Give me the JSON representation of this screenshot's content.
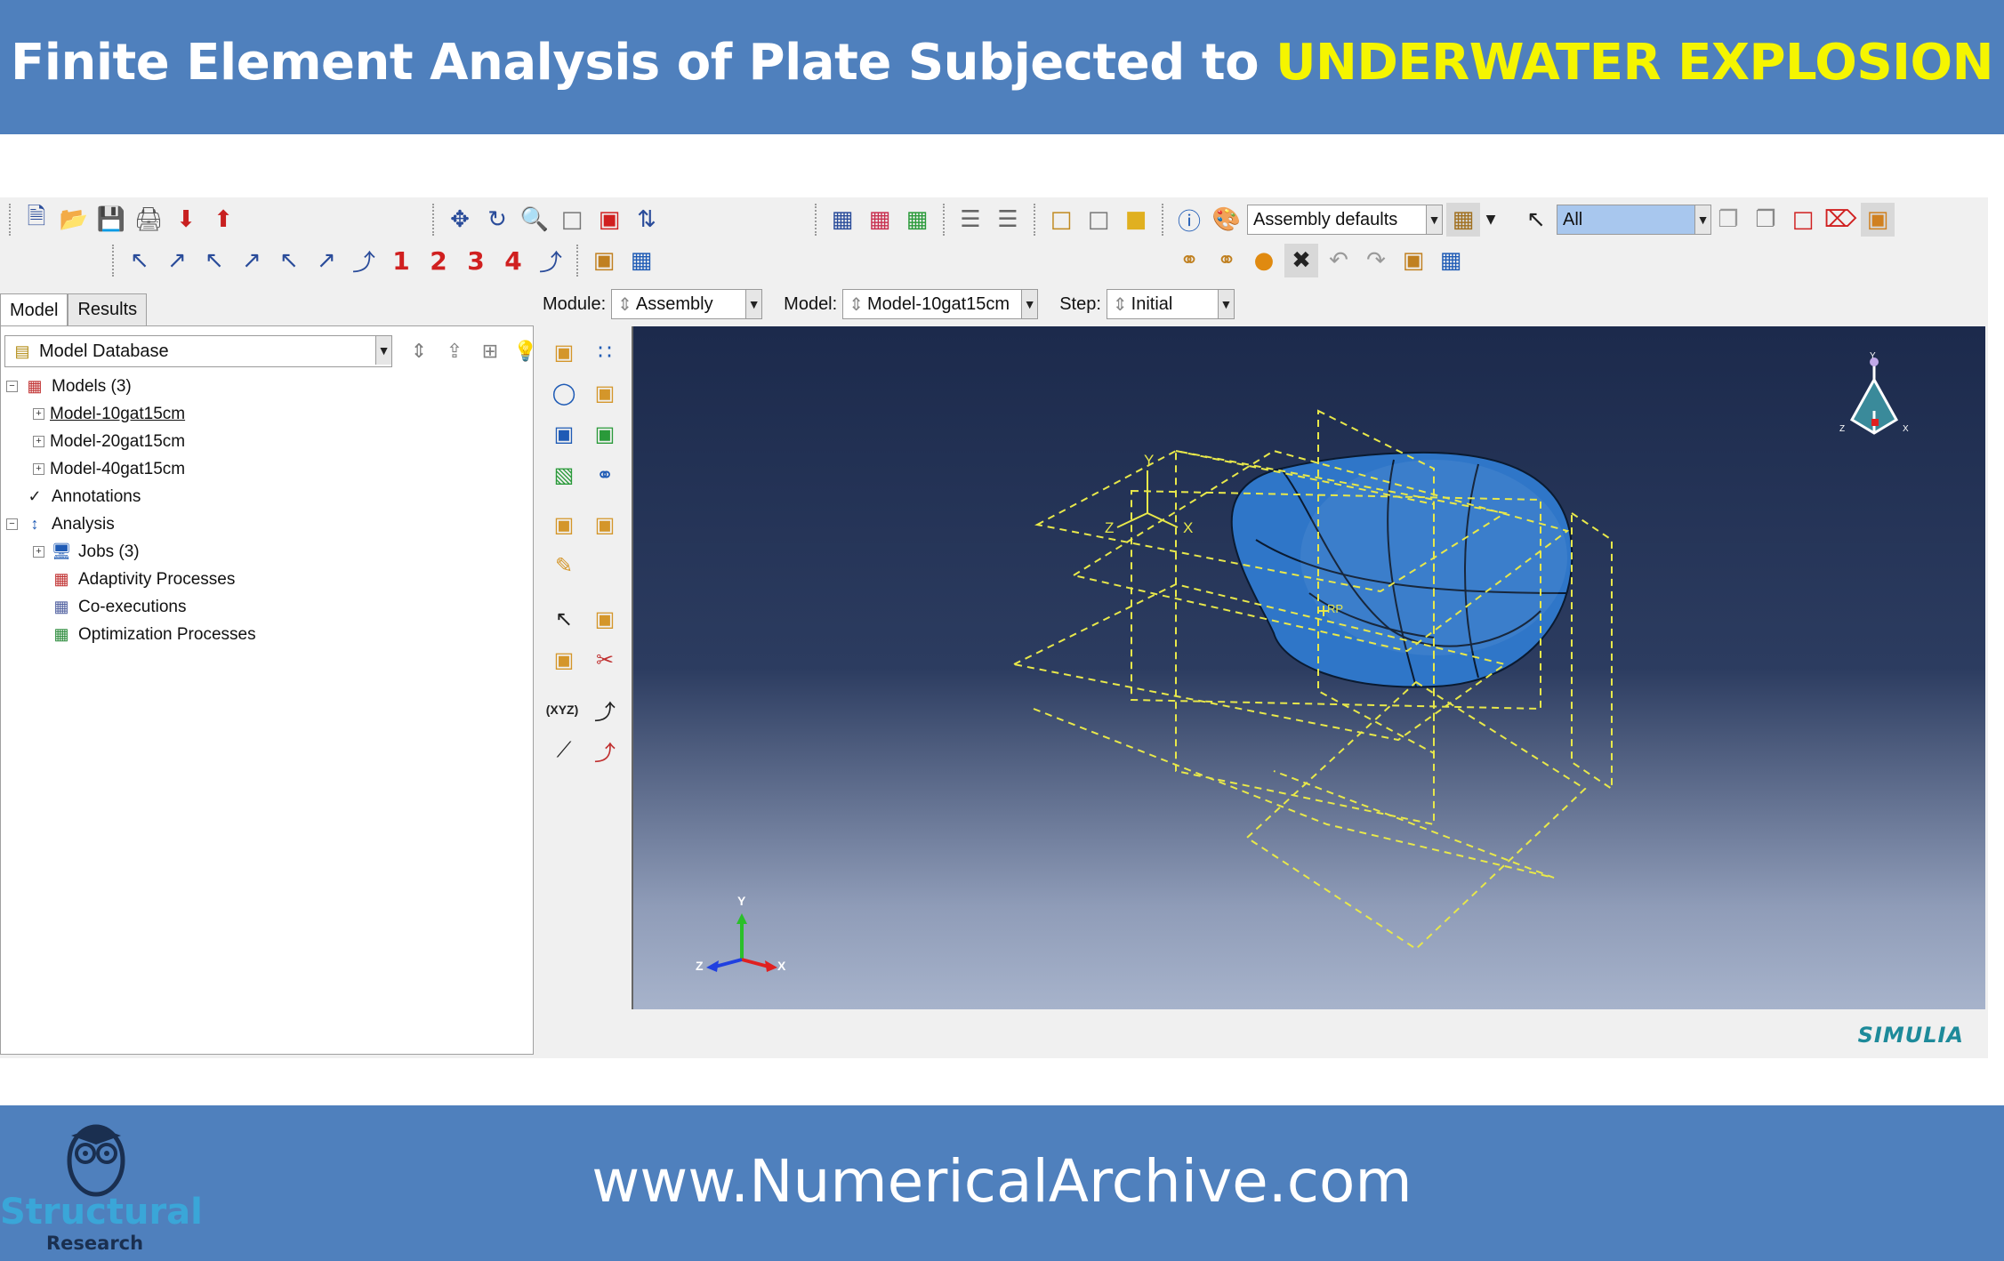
{
  "banner": {
    "title_prefix": "Finite Element Analysis of Plate Subjected to",
    "title_highlight": "UNDERWATER EXPLOSION",
    "url": "www.NumericalArchive.com",
    "logo_word": "Structural",
    "logo_sub": "Research"
  },
  "toolbar": {
    "render_style": "Assembly defaults",
    "selection_filter": "All",
    "view_numbers": [
      "1",
      "2",
      "3",
      "4"
    ]
  },
  "tabs": [
    "Model",
    "Results"
  ],
  "tree": {
    "combo": "Model Database",
    "nodes": [
      {
        "label": "Models (3)"
      },
      {
        "label": "Model-10gat15cm"
      },
      {
        "label": "Model-20gat15cm"
      },
      {
        "label": "Model-40gat15cm"
      },
      {
        "label": "Annotations"
      },
      {
        "label": "Analysis"
      },
      {
        "label": "Jobs (3)"
      },
      {
        "label": "Adaptivity Processes"
      },
      {
        "label": "Co-executions"
      },
      {
        "label": "Optimization Processes"
      }
    ]
  },
  "module_bar": {
    "module_label": "Module:",
    "module_value": "Assembly",
    "model_label": "Model:",
    "model_value": "Model-10gat15cm",
    "step_label": "Step:",
    "step_value": "Initial"
  },
  "viewport": {
    "csys_labels": {
      "y": "Y",
      "x": "X",
      "z": "Z"
    },
    "rp_label": "RP",
    "brand": "SIMULIA"
  },
  "colors": {
    "banner": "#4f80bd",
    "highlight": "#f5f500",
    "solid": "#2f76c8",
    "datum": "#e8e84a"
  }
}
